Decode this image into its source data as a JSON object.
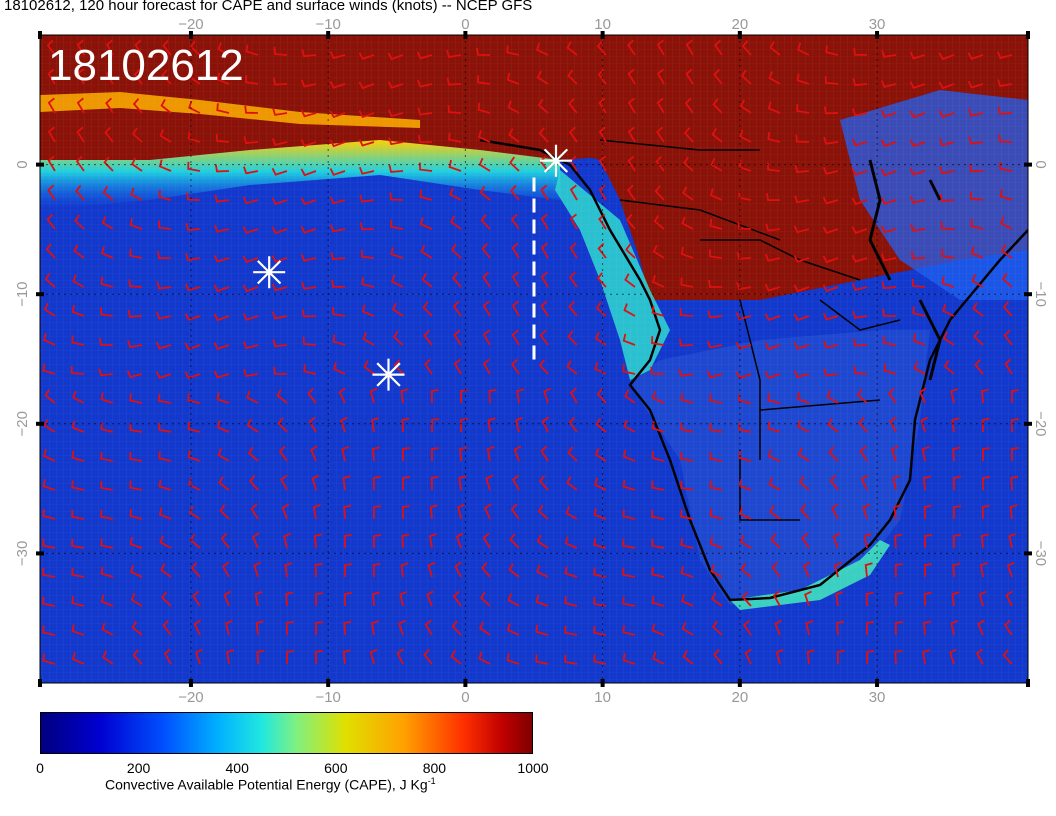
{
  "title": "18102612, 120 hour forecast for CAPE and surface winds (knots) -- NCEP GFS",
  "badge": "18102612",
  "map": {
    "lon_range": [
      -31,
      41
    ],
    "lat_range": [
      -40,
      10
    ],
    "lon_ticks": [
      {
        "value": -20,
        "label": "−20"
      },
      {
        "value": -10,
        "label": "−10"
      },
      {
        "value": 0,
        "label": "0"
      },
      {
        "value": 10,
        "label": "10"
      },
      {
        "value": 20,
        "label": "20"
      },
      {
        "value": 30,
        "label": "30"
      }
    ],
    "lat_ticks": [
      {
        "value": 0,
        "label": "0"
      },
      {
        "value": -10,
        "label": "−10"
      },
      {
        "value": -20,
        "label": "−20"
      },
      {
        "value": -30,
        "label": "−30"
      }
    ],
    "markers": [
      {
        "lon": 6.6,
        "lat": 0.3
      },
      {
        "lon": -14.3,
        "lat": -8.3
      },
      {
        "lon": -5.6,
        "lat": -16.2
      }
    ],
    "dashed_line": {
      "lon": 5.0,
      "lat_start": -1.0,
      "lat_end": -15.3
    },
    "ocean_color": "#1840d8",
    "land_color": "#8a1208",
    "barb_color": "#e01010"
  },
  "colorbar": {
    "ticks": [
      {
        "value": 0,
        "label": "0"
      },
      {
        "value": 200,
        "label": "200"
      },
      {
        "value": 400,
        "label": "400"
      },
      {
        "value": 600,
        "label": "600"
      },
      {
        "value": 800,
        "label": "800"
      },
      {
        "value": 1000,
        "label": "1000"
      }
    ],
    "min": 0,
    "max": 1000,
    "label_main": "Convective Available Potential Energy (CAPE), J Kg",
    "label_exp": "-1"
  }
}
